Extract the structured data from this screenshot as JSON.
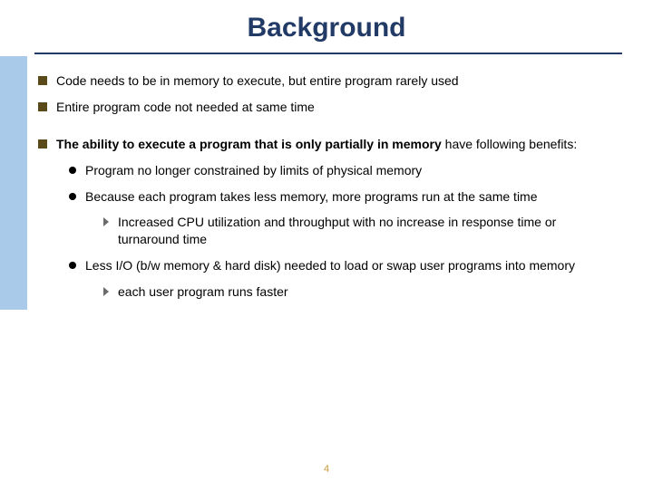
{
  "title": "Background",
  "bullets": {
    "b1": "Code needs to be in memory to execute, but entire program rarely used",
    "b2": "Entire program code not needed at same time",
    "b3_bold": "The ability to execute a program that is only partially in memory ",
    "b3_rest": "have following benefits:",
    "s1": "Program no longer constrained by limits of physical memory",
    "s2": "Because each program takes less memory, more programs run at the same time",
    "s2a": "Increased CPU utilization and throughput with no increase in response time or turnaround time",
    "s3": "Less I/O  (b/w memory & hard disk) needed to load or swap user programs into memory",
    "s3a": " each user program runs faster"
  },
  "page_number": "4"
}
